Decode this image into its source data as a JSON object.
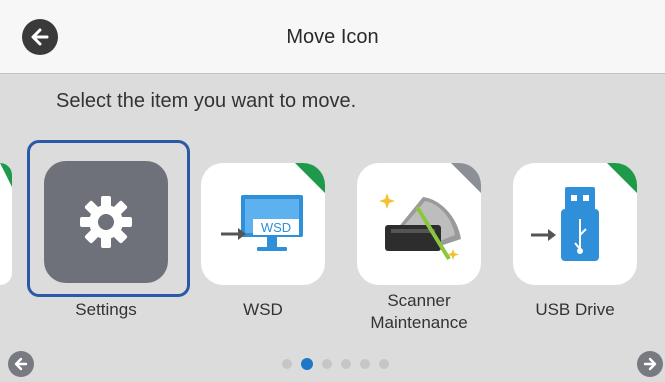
{
  "header": {
    "title": "Move Icon",
    "back_icon": "back-arrow-icon"
  },
  "instruction": "Select the item you want to move.",
  "tiles": [
    {
      "label": "Settings",
      "icon": "gear-icon",
      "selected": true
    },
    {
      "label": "WSD",
      "icon": "wsd-icon",
      "corner": "#1e9a4a"
    },
    {
      "label_line1": "Scanner",
      "label_line2": "Maintenance",
      "icon": "scanner-maintenance-icon",
      "corner": "#8d8f96"
    },
    {
      "label": "USB Drive",
      "icon": "usb-drive-icon",
      "corner": "#1e9a4a"
    }
  ],
  "pagination": {
    "page_count": 6,
    "current_page": 2,
    "prev_icon": "prev-page-arrow-icon",
    "next_icon": "next-page-arrow-icon"
  },
  "colors": {
    "selection_border": "#2a5aa6",
    "active_dot": "#1f77c8",
    "corner_green": "#1e9a4a"
  }
}
